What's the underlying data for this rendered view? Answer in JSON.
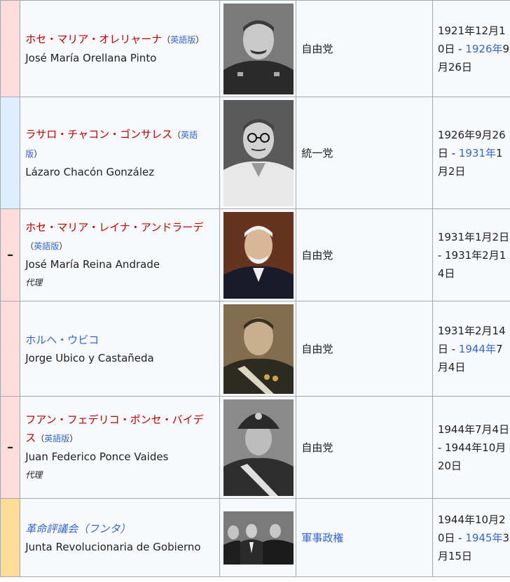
{
  "rows": [
    {
      "jp_name": "ホセ・マリア・オレリャーナ",
      "en_open": "（",
      "en_link": "英語版",
      "en_close": "）",
      "latin_name": "José María Orellana Pinto",
      "acting": "",
      "party": "自由党",
      "term_start": "1921年12月10日",
      "term_dash": " - ",
      "term_end_link": "1926年",
      "term_end_rest": "9月26日",
      "color": "#ffdddd",
      "marker": ""
    },
    {
      "jp_name": "ラサロ・チャコン・ゴンサレス",
      "en_open": "（",
      "en_link": "英語版",
      "en_close": "）",
      "latin_name": "Lázaro Chacón González",
      "acting": "",
      "party": "統一党",
      "term_start": "1926年9月26日",
      "term_dash": " - ",
      "term_end_link": "1931年",
      "term_end_rest": "1月2日",
      "color": "#ddeeff",
      "marker": ""
    },
    {
      "jp_name": "ホセ・マリア・レイナ・アンドラーデ",
      "en_open": "（",
      "en_link": "英語版",
      "en_close": "）",
      "latin_name": "José María Reina Andrade",
      "acting": "代理",
      "party": "自由党",
      "term_start": "1931年1月2日",
      "term_dash": " - ",
      "term_end_text": "1931年2月14日",
      "color": "#ffdddd",
      "marker": "–"
    },
    {
      "jp_name": "ホルヘ・ウビコ",
      "latin_name": "Jorge Ubico y Castañeda",
      "acting": "",
      "party": "自由党",
      "term_start": "1931年2月14日",
      "term_dash": " - ",
      "term_end_link": "1944年",
      "term_end_rest": "7月4日",
      "color": "#ffdddd",
      "marker": ""
    },
    {
      "jp_name": "フアン・フェデリコ・ポンセ・バイデス",
      "en_open": "（",
      "en_link": "英語版",
      "en_close": "）",
      "latin_name": "Juan Federico Ponce Vaides",
      "acting": "代理",
      "party": "自由党",
      "term_start": "1944年7月4日",
      "term_dash": " - ",
      "term_end_text": "1944年10月20日",
      "color": "#ffdddd",
      "marker": "–"
    },
    {
      "jp_name": "革命評議会（フンタ）",
      "latin_name": "Junta Revolucionaria de Gobierno",
      "acting": "",
      "party": "軍事政権",
      "term_start": "1944年10月20日",
      "term_dash": " - ",
      "term_end_link": "1945年",
      "term_end_rest": "3月15日",
      "color": "#ffdd99",
      "marker": ""
    }
  ]
}
